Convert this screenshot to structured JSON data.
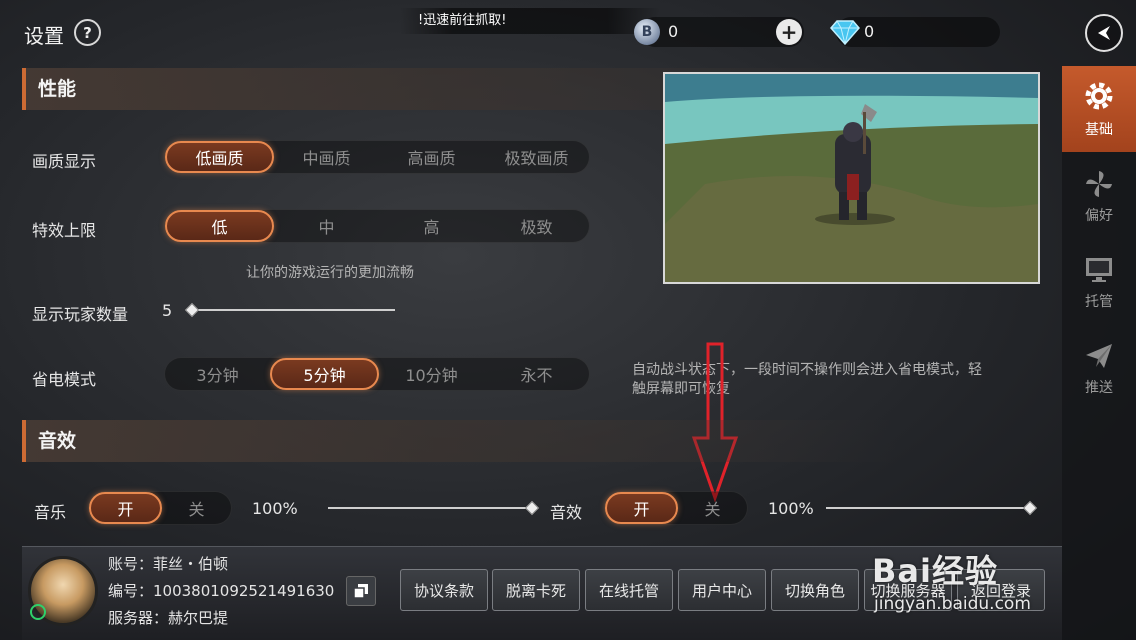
{
  "header": {
    "title": "设置",
    "help_symbol": "?",
    "marquee_text": "!迅速前往抓取!",
    "coin_symbol": "B",
    "coin_value": "0",
    "diamond_value": "0"
  },
  "sidebar": {
    "items": [
      {
        "label": "基础",
        "icon": "gear-icon",
        "active": true
      },
      {
        "label": "偏好",
        "icon": "pinwheel-icon",
        "active": false
      },
      {
        "label": "托管",
        "icon": "monitor-icon",
        "active": false
      },
      {
        "label": "推送",
        "icon": "paper-plane-icon",
        "active": false
      }
    ]
  },
  "performance": {
    "title": "性能",
    "quality": {
      "label": "画质显示",
      "options": [
        "低画质",
        "中画质",
        "高画质",
        "极致画质"
      ],
      "selected": "低画质"
    },
    "effects": {
      "label": "特效上限",
      "options": [
        "低",
        "中",
        "高",
        "极致"
      ],
      "selected": "低"
    },
    "effects_hint": "让你的游戏运行的更加流畅",
    "players": {
      "label": "显示玩家数量",
      "value": "5"
    },
    "power_save": {
      "label": "省电模式",
      "options": [
        "3分钟",
        "5分钟",
        "10分钟",
        "永不"
      ],
      "selected": "5分钟"
    },
    "power_hint_line1": "自动战斗状态下，一段时间不操作则会进入省电模式，轻",
    "power_hint_line2": "触屏幕即可恢复"
  },
  "sound": {
    "title": "音效",
    "music": {
      "label": "音乐",
      "on": "开",
      "off": "关",
      "volume": "100%"
    },
    "sfx": {
      "label": "音效",
      "on": "开",
      "off": "关",
      "volume": "100%"
    }
  },
  "account": {
    "account_line": "账号：菲丝・伯顿",
    "id_line": "编号：1003801092521491630",
    "server_line": "服务器：赫尔巴提",
    "buttons": [
      "协议条款",
      "脱离卡死",
      "在线托管",
      "用户中心",
      "切换角色",
      "切换服务器",
      "返回登录"
    ]
  },
  "watermark": {
    "brand": "Bai经验",
    "url": "jingyan.baidu.com"
  },
  "colors": {
    "accent": "#cd6b34",
    "annotation_arrow": "#e0222a"
  }
}
